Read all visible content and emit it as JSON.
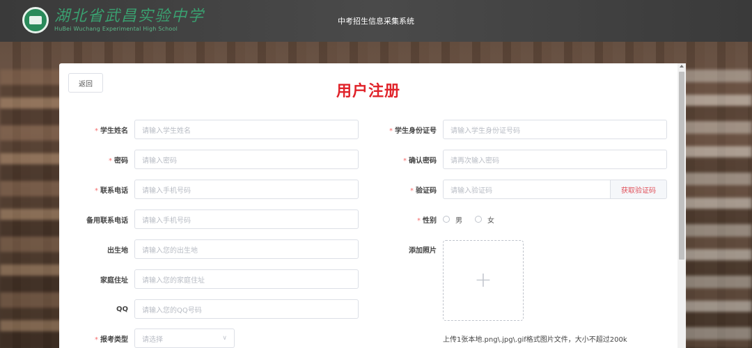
{
  "header": {
    "logo_cn": "湖北省武昌实验中学",
    "logo_en": "HuBei Wuchang Experimental High School",
    "system_title": "中考招生信息采集系统"
  },
  "page": {
    "back_label": "返回",
    "title": "用户注册"
  },
  "form": {
    "left": [
      {
        "label": "学生姓名",
        "required": true,
        "placeholder": "请输入学生姓名"
      },
      {
        "label": "密码",
        "required": true,
        "placeholder": "请输入密码"
      },
      {
        "label": "联系电话",
        "required": true,
        "placeholder": "请输入手机号码"
      },
      {
        "label": "备用联系电话",
        "required": false,
        "placeholder": "请输入手机号码"
      },
      {
        "label": "出生地",
        "required": false,
        "placeholder": "请输入您的出生地"
      },
      {
        "label": "家庭住址",
        "required": false,
        "placeholder": "请输入您的家庭住址"
      },
      {
        "label": "QQ",
        "required": false,
        "placeholder": "请输入您的QQ号码"
      },
      {
        "label": "报考类型",
        "required": true,
        "placeholder": "请选择"
      }
    ],
    "right": {
      "id_card": {
        "label": "学生身份证号",
        "placeholder": "请输入学生身份证号码"
      },
      "confirm_password": {
        "label": "确认密码",
        "placeholder": "请再次输入密码"
      },
      "verify_code": {
        "label": "验证码",
        "placeholder": "请输入验证码",
        "button": "获取验证码"
      },
      "gender": {
        "label": "性别",
        "options": [
          "男",
          "女"
        ]
      },
      "photo": {
        "label": "添加照片",
        "tip": "上传1张本地.png\\.jpg\\.gif格式图片文件，大小不超过200k"
      }
    },
    "required_mark": "*"
  },
  "colors": {
    "accent": "#e0232a",
    "required": "#f56c6c"
  },
  "icons": {
    "upload": "plus-icon",
    "select": "chevron-down-icon"
  }
}
